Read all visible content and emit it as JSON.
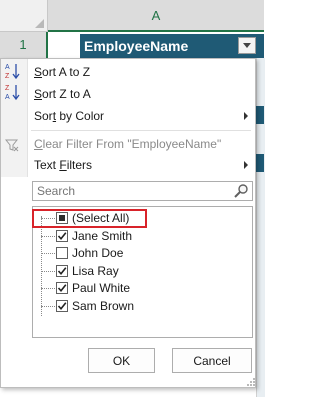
{
  "sheet": {
    "column_header": "A",
    "row_number": "1",
    "header_cell": "EmployeeName"
  },
  "menu": {
    "sort_a_z": {
      "pre": "",
      "u": "S",
      "post": "ort A to Z"
    },
    "sort_z_a": {
      "pre": "",
      "u": "S",
      "post": "ort Z to A"
    },
    "sort_by_color": {
      "pre": "Sor",
      "u": "t",
      "post": " by Color"
    },
    "clear_filter": {
      "pre": "",
      "u": "C",
      "post": "lear Filter From \"EmployeeName\""
    },
    "text_filters": {
      "pre": "",
      "u": "F",
      "post": "ilters",
      "prefix": "Text "
    }
  },
  "search": {
    "placeholder": "Search"
  },
  "list": [
    {
      "label": "(Select All)",
      "state": "partial"
    },
    {
      "label": "Jane Smith",
      "state": "checked"
    },
    {
      "label": "John Doe",
      "state": "unchecked"
    },
    {
      "label": "Lisa Ray",
      "state": "checked"
    },
    {
      "label": "Paul White",
      "state": "checked"
    },
    {
      "label": "Sam Brown",
      "state": "checked"
    }
  ],
  "buttons": {
    "ok": "OK",
    "cancel": "Cancel"
  },
  "colors": {
    "accent": "#217346",
    "header_fill": "#1f5a75",
    "highlight": "#d8232a"
  }
}
